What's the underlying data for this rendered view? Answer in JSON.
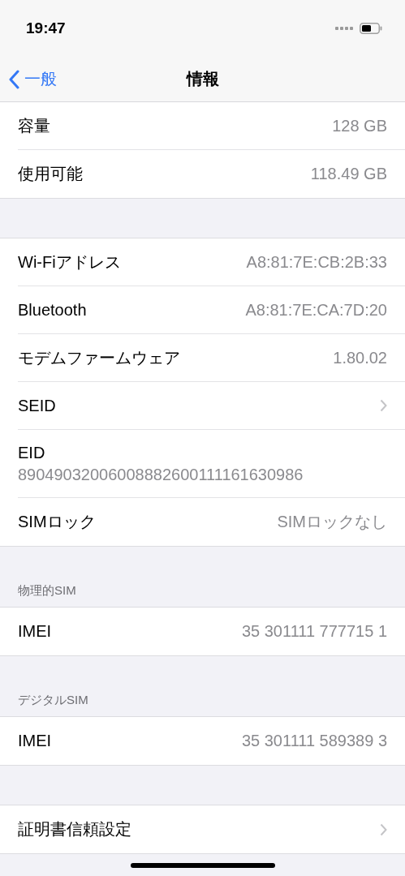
{
  "status_bar": {
    "time": "19:47"
  },
  "nav": {
    "back": "一般",
    "title": "情報"
  },
  "sections": [
    {
      "rows": [
        {
          "kind": "value",
          "label": "容量",
          "value": "128 GB"
        },
        {
          "kind": "value",
          "label": "使用可能",
          "value": "118.49 GB"
        }
      ]
    },
    {
      "rows": [
        {
          "kind": "value",
          "label": "Wi-Fiアドレス",
          "value": "A8:81:7E:CB:2B:33"
        },
        {
          "kind": "value",
          "label": "Bluetooth",
          "value": "A8:81:7E:CA:7D:20"
        },
        {
          "kind": "value",
          "label": "モデムファームウェア",
          "value": "1.80.02"
        },
        {
          "kind": "chevron",
          "label": "SEID"
        },
        {
          "kind": "stacked",
          "label": "EID",
          "value": "89049032006008882600111161630986"
        },
        {
          "kind": "value",
          "label": "SIMロック",
          "value": "SIMロックなし"
        }
      ]
    },
    {
      "header": "物理的SIM",
      "rows": [
        {
          "kind": "value",
          "label": "IMEI",
          "value": "35 301111 777715 1"
        }
      ]
    },
    {
      "header": "デジタルSIM",
      "rows": [
        {
          "kind": "value",
          "label": "IMEI",
          "value": "35 301111 589389 3"
        }
      ]
    },
    {
      "rows": [
        {
          "kind": "chevron",
          "label": "証明書信頼設定"
        }
      ]
    }
  ]
}
